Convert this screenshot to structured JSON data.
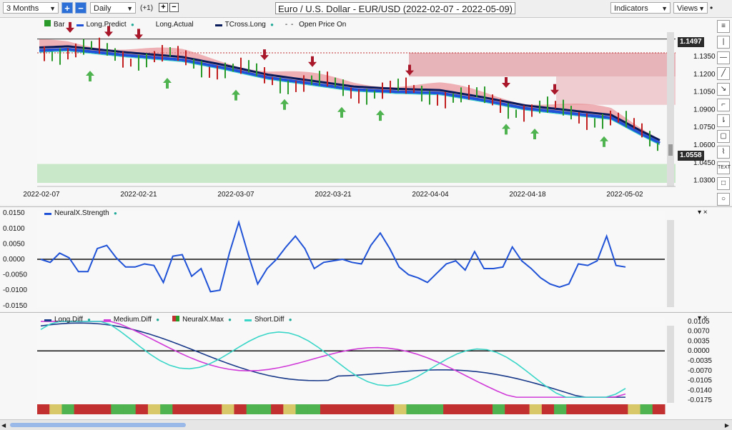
{
  "toolbar": {
    "range": "3 Months",
    "zoom_in": "+",
    "zoom_out": "−",
    "interval": "Daily",
    "offset": "(+1)",
    "step_plus": "+",
    "step_minus": "−",
    "title": "Euro / U.S. Dollar - EUR/USD (2022-02-07 - 2022-05-09)",
    "indicators": "Indicators",
    "views": "Views"
  },
  "main_legend": {
    "items": [
      {
        "label": "Bar",
        "color": "#2a9a2a"
      },
      {
        "label": "Long.Predict",
        "color": "#1f52d6"
      },
      {
        "label": "Long.Actual",
        "color": "#ffffff"
      },
      {
        "label": "TCross.Long",
        "color": "#0a1b5c"
      },
      {
        "label": "Open Price On",
        "color": "#444444"
      }
    ]
  },
  "price_axis": [
    "1.1350",
    "1.1200",
    "1.1050",
    "1.0900",
    "1.0750",
    "1.0600",
    "1.0450",
    "1.0300"
  ],
  "price_tags": {
    "high": "1.1497",
    "current": "1.0558"
  },
  "date_axis": [
    "2022-02-07",
    "2022-02-21",
    "2022-03-07",
    "2022-03-21",
    "2022-04-04",
    "2022-04-18",
    "2022-05-02"
  ],
  "strength_panel": {
    "legend": "NeuralX.Strength",
    "axis": [
      "0.0150",
      "0.0100",
      "0.0050",
      "0.0000",
      "-0.0050",
      "-0.0100",
      "-0.0150"
    ],
    "controls": "▾ ×"
  },
  "diff_panel": {
    "legend": [
      "Long.Diff",
      "Medium.Diff",
      "NeuralX.Max",
      "Short.Diff"
    ],
    "legend_colors": [
      "#1a3a8a",
      "#d03ad8",
      "#c23030",
      "#3ad6c8"
    ],
    "axis": [
      "0.0105",
      "0.0070",
      "0.0035",
      "0.0000",
      "-0.0035",
      "-0.0070",
      "-0.0105",
      "-0.0140",
      "-0.0175"
    ],
    "controls": "▾ ×"
  },
  "sidebar_tools": [
    "≡",
    "|",
    "—",
    "╱",
    "↘",
    "⌐",
    "⇂",
    "▢",
    "⌇",
    "TEXT",
    "□",
    "○",
    "×"
  ],
  "chart_data": {
    "type": "line",
    "main": {
      "x": [
        "2022-02-07",
        "2022-02-21",
        "2022-03-07",
        "2022-03-21",
        "2022-04-04",
        "2022-04-18",
        "2022-05-02",
        "2022-05-09"
      ],
      "long_predict": [
        1.14,
        1.133,
        1.115,
        1.106,
        1.103,
        1.088,
        1.056,
        1.058
      ],
      "tcross_long": [
        1.142,
        1.135,
        1.118,
        1.108,
        1.104,
        1.09,
        1.062,
        1.064
      ],
      "long_actual": [
        1.146,
        1.136,
        1.11,
        1.101,
        1.098,
        1.083,
        1.048,
        1.051
      ],
      "ylim": [
        1.025,
        1.1555
      ]
    },
    "strength": [
      0.0,
      -0.001,
      0.002,
      0.0005,
      -0.004,
      -0.004,
      0.0035,
      0.0045,
      0.0005,
      -0.0025,
      -0.0025,
      -0.0015,
      -0.002,
      -0.0075,
      0.001,
      0.0015,
      -0.0055,
      -0.003,
      -0.0105,
      -0.01,
      0.002,
      0.012,
      0.0015,
      -0.008,
      -0.003,
      0.0,
      0.004,
      0.0075,
      0.0035,
      -0.003,
      -0.001,
      -0.0005,
      0.0,
      -0.001,
      -0.0015,
      0.0045,
      0.0085,
      0.0035,
      -0.0025,
      -0.005,
      -0.006,
      -0.0075,
      -0.0045,
      -0.0015,
      -0.0005,
      -0.0035,
      0.0025,
      -0.003,
      -0.003,
      -0.0025,
      0.004,
      -0.0005,
      -0.003,
      -0.006,
      -0.008,
      -0.009,
      -0.008,
      -0.0015,
      -0.002,
      -0.0005,
      0.0075,
      -0.002,
      -0.0025
    ],
    "strength_ylim": [
      -0.0155,
      0.0155
    ],
    "diff_ylim": [
      -0.0185,
      0.012
    ]
  }
}
